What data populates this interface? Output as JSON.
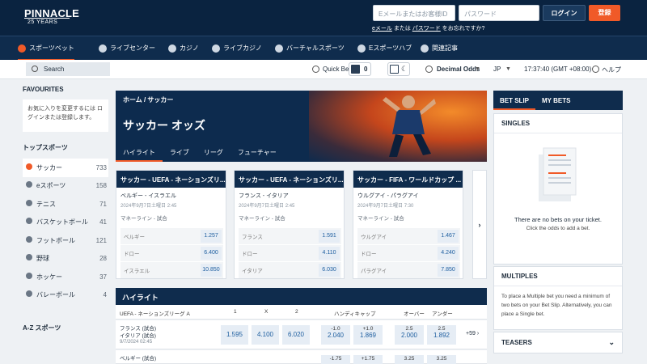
{
  "brand": {
    "name": "PINNACLE",
    "tagline": "25 YEARS"
  },
  "auth": {
    "email_placeholder": "Eメールまたはお客様ID",
    "password_placeholder": "パスワード",
    "login_label": "ログイン",
    "register_label": "登録",
    "forgot_prefix": "eメール",
    "forgot_mid": " または ",
    "forgot_link": "パスワード",
    "forgot_suffix": " をお忘れですか?"
  },
  "nav": [
    {
      "label": "スポーツベット",
      "icon": "soccer-ball-icon"
    },
    {
      "label": "ライブセンター",
      "icon": "live-icon"
    },
    {
      "label": "カジノ",
      "icon": "casino-icon"
    },
    {
      "label": "ライブカジノ",
      "icon": "roulette-icon"
    },
    {
      "label": "バーチャルスポーツ",
      "icon": "virtual-icon"
    },
    {
      "label": "Eスポーツハブ",
      "icon": "esports-icon"
    },
    {
      "label": "関連記事",
      "icon": "article-icon"
    }
  ],
  "toolbar": {
    "search_label": "Search",
    "quickbet_label": "Quick Bet",
    "quickbet_value": "0",
    "odds_format": "Decimal Odds",
    "language": "JP",
    "time": "17:37:40 (GMT +08:00)",
    "help": "ヘルプ"
  },
  "sidebar": {
    "favourites_title": "FAVOURITES",
    "favourites_note": "お気に入りを変更するには ログインまたは登録します。",
    "top_sports_title": "トップスポーツ",
    "sports": [
      {
        "label": "サッカー",
        "count": "733"
      },
      {
        "label": "eスポーツ",
        "count": "158"
      },
      {
        "label": "テニス",
        "count": "71"
      },
      {
        "label": "バスケットボール",
        "count": "41"
      },
      {
        "label": "フットボール",
        "count": "121"
      },
      {
        "label": "野球",
        "count": "28"
      },
      {
        "label": "ホッケー",
        "count": "37"
      },
      {
        "label": "バレーボール",
        "count": "4"
      }
    ],
    "az_title": "A-Z スポーツ"
  },
  "hero": {
    "breadcrumb": "ホーム / サッカー",
    "title": "サッカー オッズ",
    "tabs": [
      "ハイライト",
      "ライブ",
      "リーグ",
      "フューチャー"
    ]
  },
  "cards": [
    {
      "league": "サッカー - UEFA - ネーションズリ...",
      "teams": "ベルギー - イスラエル",
      "date": "2024年9月7日土曜日 2:45",
      "market": "マネーライン - 試合",
      "odds": [
        {
          "label": "ベルギー",
          "value": "1.257"
        },
        {
          "label": "ドロー",
          "value": "6.400"
        },
        {
          "label": "イスラエル",
          "value": "10.850"
        }
      ]
    },
    {
      "league": "サッカー - UEFA - ネーションズリ...",
      "teams": "フランス - イタリア",
      "date": "2024年9月7日土曜日 2:45",
      "market": "マネーライン - 試合",
      "odds": [
        {
          "label": "フランス",
          "value": "1.591"
        },
        {
          "label": "ドロー",
          "value": "4.110"
        },
        {
          "label": "イタリア",
          "value": "6.030"
        }
      ]
    },
    {
      "league": "サッカー - FIFA - ワールドカップ ...",
      "teams": "ウルグアイ - パラグアイ",
      "date": "2024年9月7日土曜日 7:30",
      "market": "マネーライン - 試合",
      "odds": [
        {
          "label": "ウルグアイ",
          "value": "1.467"
        },
        {
          "label": "ドロー",
          "value": "4.240"
        },
        {
          "label": "パラグアイ",
          "value": "7.850"
        }
      ]
    }
  ],
  "highlights": {
    "title": "ハイライト",
    "league": "UEFA - ネーションズリーグ A",
    "cols": [
      "1",
      "X",
      "2",
      "ハンディキャップ",
      "オーバー",
      "アンダー"
    ],
    "rows": [
      {
        "home": "フランス (試合)",
        "away": "イタリア (試合)",
        "date": "9/7/2024 02:45",
        "o1": "1.595",
        "ox": "4.100",
        "o2": "6.020",
        "hc1_line": "-1.0",
        "hc1": "2.040",
        "hc2_line": "+1.0",
        "hc2": "1.869",
        "ov_line": "2.5",
        "ov": "2.000",
        "un_line": "2.5",
        "un": "1.892",
        "more": "+59 ›"
      },
      {
        "home": "ベルギー (試合)",
        "away": "",
        "date": "",
        "o1": "",
        "ox": "",
        "o2": "",
        "hc1_line": "-1.75",
        "hc1": "",
        "hc2_line": "+1.75",
        "hc2": "",
        "ov_line": "3.25",
        "ov": "",
        "un_line": "3.25",
        "un": "",
        "more": ""
      }
    ]
  },
  "betslip": {
    "tabs": [
      "BET SLIP",
      "MY BETS"
    ],
    "singles": "SINGLES",
    "empty_title": "There are no bets on your ticket.",
    "empty_sub": "Click the odds to add a bet.",
    "multiples": "MULTIPLES",
    "multiples_text": "To place a Multiple bet you need a minimum of two bets on your Bet Slip. Alternatively, you can place a Single bet.",
    "teasers": "TEASERS"
  },
  "colors": {
    "navy": "#0a2340",
    "accent": "#f05a28",
    "odds_blue": "#1f5fa0"
  }
}
